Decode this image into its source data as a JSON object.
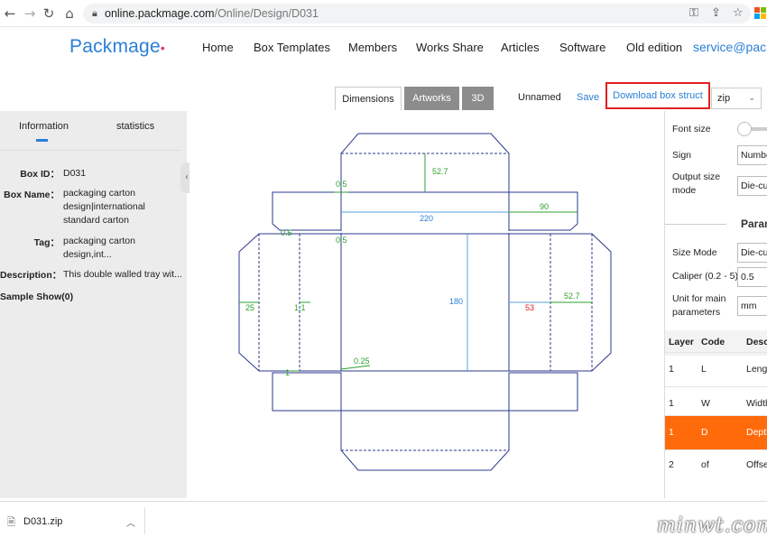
{
  "browser": {
    "url_host": "online.packmage.com",
    "url_path": "/Online/Design/D031"
  },
  "header": {
    "logo": "Packmage",
    "menu": [
      "Home",
      "Box Templates",
      "Members",
      "Works Share",
      "Articles",
      "Software",
      "Old edition"
    ],
    "email": "service@pacl"
  },
  "toolbar": {
    "tabs": [
      "Dimensions",
      "Artworks",
      "3D"
    ],
    "filename": "Unnamed",
    "save": "Save",
    "download": "Download box struct",
    "format": "zip"
  },
  "left_panel": {
    "tabs": [
      "Information",
      "statistics"
    ],
    "fields": [
      {
        "label": "Box ID：",
        "value": "D031"
      },
      {
        "label": "Box Name：",
        "value": "packaging carton design|international standard carton"
      },
      {
        "label": "Tag：",
        "value": "packaging carton design,int..."
      },
      {
        "label": "Description：",
        "value": "This double walled tray wit..."
      }
    ],
    "sample_show": "Sample Show(0)"
  },
  "canvas": {
    "dimensions": [
      "52.7",
      "0.5",
      "90",
      "220",
      "0.5",
      "0.5",
      "180",
      "25",
      "1.1",
      "53",
      "52.7",
      "0.25",
      "1"
    ]
  },
  "right_panel": {
    "font_size_label": "Font size",
    "sign_label": "Sign",
    "sign_value": "Number",
    "output_size_label": "Output size mode",
    "output_size_value": "Die-cut",
    "param_title": "Param",
    "size_mode_label": "Size Mode",
    "size_mode_value": "Die-cut",
    "caliper_label": "Caliper (0.2 - 5)",
    "caliper_value": "0.5",
    "unit_label": "Unit for main parameters",
    "unit_value": "mm",
    "table_headers": [
      "Layer",
      "Code",
      "Desc"
    ],
    "table_rows": [
      {
        "layer": "1",
        "code": "L",
        "desc": "Leng"
      },
      {
        "layer": "1",
        "code": "W",
        "desc": "Width"
      },
      {
        "layer": "1",
        "code": "D",
        "desc": "Depth"
      },
      {
        "layer": "2",
        "code": "of",
        "desc": "Offse"
      }
    ]
  },
  "downloads": {
    "file": "D031.zip"
  },
  "watermark": "minwt.com"
}
